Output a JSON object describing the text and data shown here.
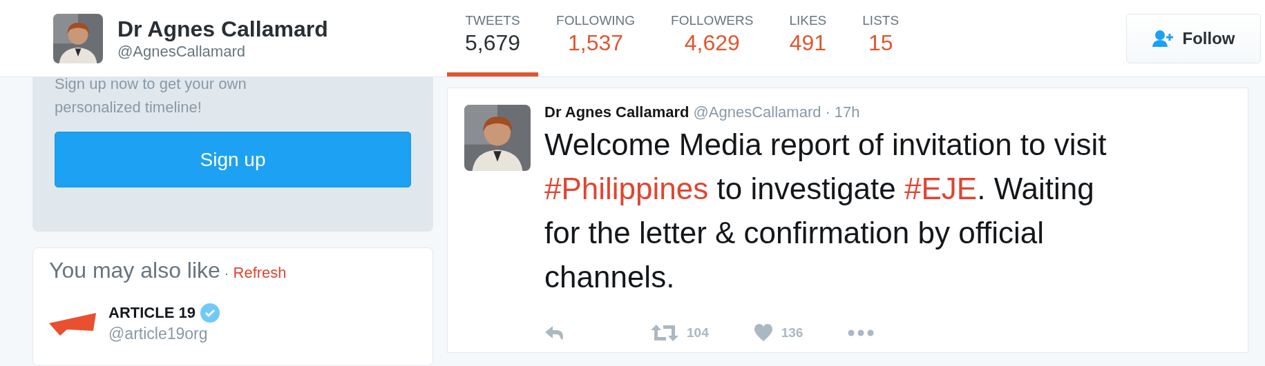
{
  "profile": {
    "name": "Dr Agnes Callamard",
    "handle": "@AgnesCallamard"
  },
  "stats": [
    {
      "label": "TWEETS",
      "value": "5,679",
      "selected": true
    },
    {
      "label": "FOLLOWING",
      "value": "1,537",
      "selected": false
    },
    {
      "label": "FOLLOWERS",
      "value": "4,629",
      "selected": false
    },
    {
      "label": "LIKES",
      "value": "491",
      "selected": false
    },
    {
      "label": "LISTS",
      "value": "15",
      "selected": false
    }
  ],
  "follow_button": {
    "label": "Follow"
  },
  "signup_card": {
    "text": "Sign up now to get your own personalized timeline!",
    "button": "Sign up"
  },
  "suggestions": {
    "title": "You may also like",
    "separator": "·",
    "refresh": "Refresh",
    "accounts": [
      {
        "name": "ARTICLE 19",
        "handle": "@article19org",
        "verified": true
      }
    ]
  },
  "tweet": {
    "name": "Dr Agnes Callamard",
    "handle": "@AgnesCallamard",
    "separator": "·",
    "time": "17h",
    "segments": [
      {
        "kind": "text",
        "text": "Welcome Media report of invitation to visit "
      },
      {
        "kind": "hashtag",
        "text": "#Philippines"
      },
      {
        "kind": "text",
        "text": " to investigate "
      },
      {
        "kind": "hashtag",
        "text": "#EJE"
      },
      {
        "kind": "text",
        "text": ". Waiting for the letter & confirmation by official channels."
      }
    ],
    "actions": [
      {
        "kind": "reply"
      },
      {
        "kind": "retweet",
        "count": "104"
      },
      {
        "kind": "like",
        "count": "136"
      },
      {
        "kind": "more"
      }
    ]
  }
}
